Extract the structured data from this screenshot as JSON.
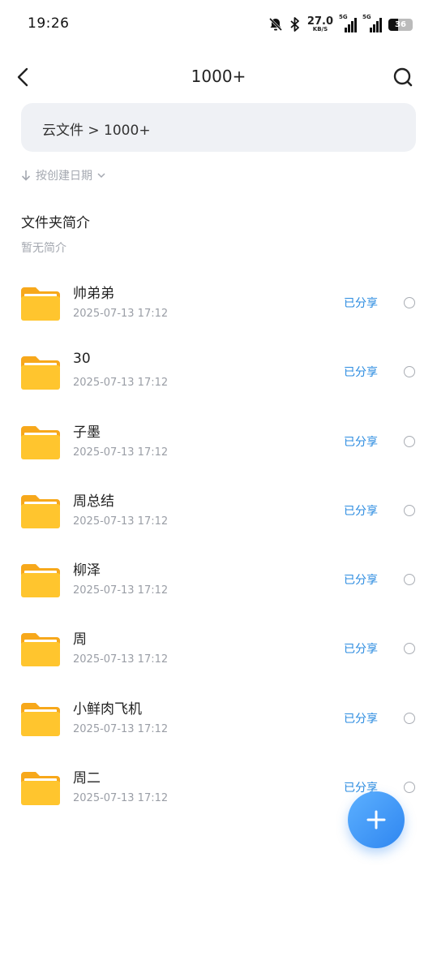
{
  "status_bar": {
    "time": "19:26",
    "net_speed": "27.0",
    "net_speed_unit": "KB/S",
    "sim1_label": "5G",
    "sim2_label": "5G",
    "battery": "36"
  },
  "header": {
    "title": "1000+"
  },
  "breadcrumb": {
    "path": "云文件 > 1000+"
  },
  "sort": {
    "label": "按创建日期"
  },
  "folder_description": {
    "title": "文件夹简介",
    "text": "暂无简介"
  },
  "files": [
    {
      "name": "帅弟弟",
      "date": "2025-07-13 17:12",
      "status": "已分享"
    },
    {
      "name": "30",
      "date": "2025-07-13 17:12",
      "status": "已分享"
    },
    {
      "name": "子墨",
      "date": "2025-07-13 17:12",
      "status": "已分享"
    },
    {
      "name": "周总结",
      "date": "2025-07-13 17:12",
      "status": "已分享"
    },
    {
      "name": "柳泽",
      "date": "2025-07-13 17:12",
      "status": "已分享"
    },
    {
      "name": "周",
      "date": "2025-07-13 17:12",
      "status": "已分享"
    },
    {
      "name": "小鲜肉飞机",
      "date": "2025-07-13 17:12",
      "status": "已分享"
    },
    {
      "name": "周二",
      "date": "2025-07-13 17:12",
      "status": "已分享"
    }
  ],
  "colors": {
    "accent": "#2a8be0",
    "folder": "#ffc52e",
    "folder_tab": "#f7a81b"
  }
}
